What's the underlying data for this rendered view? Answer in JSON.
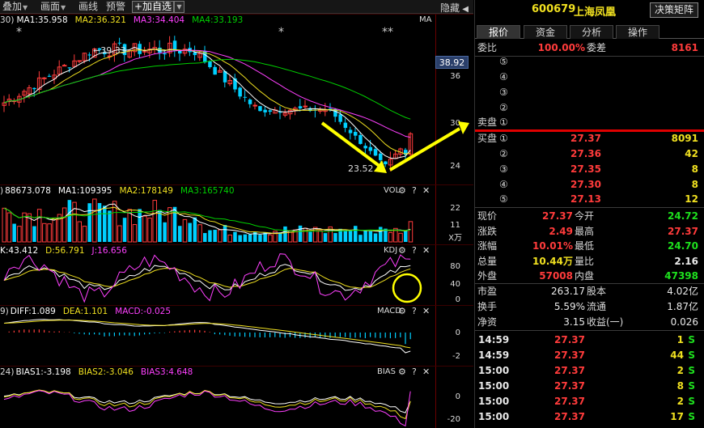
{
  "toolbar": {
    "overlay_label": "叠加",
    "draw_label": "画面",
    "line_label": "画线",
    "alert_label": "预警",
    "add_watch_label": "+加自选",
    "hide_label": "隐藏"
  },
  "kline": {
    "header_prefix": "30)",
    "ma1": "MA1:35.958",
    "ma2": "MA2:36.321",
    "ma3": "MA3:34.404",
    "ma4": "MA4:33.193",
    "ma_tag": "MA",
    "high_label": "←39.33",
    "low_label": "23.52",
    "star1": "*",
    "star2": "*",
    "star3": "**",
    "price_axis": [
      "36",
      "30",
      "24"
    ],
    "last_price_tag": "38.92"
  },
  "vol": {
    "header_prefix": ")",
    "vol_value": "88673.078",
    "ma1": "MA1:109395",
    "ma2": "MA2:178149",
    "ma3": "MA3:165740",
    "title": "VOL",
    "axis": [
      "22",
      "11"
    ],
    "unit": "X万"
  },
  "kdj": {
    "k": "K:43.412",
    "d": "D:56.791",
    "j": "J:16.656",
    "title": "KDJ",
    "axis": [
      "80",
      "40",
      "0"
    ]
  },
  "macd": {
    "header_prefix": "9)",
    "diff": "DIFF:1.089",
    "dea": "DEA:1.101",
    "macd": "MACD:-0.025",
    "title": "MACD",
    "axis": [
      "0",
      "-2"
    ]
  },
  "bias": {
    "header_prefix": "24)",
    "bias1": "BIAS1:-3.198",
    "bias2": "BIAS2:-3.046",
    "bias3": "BIAS3:4.648",
    "title": "BIAS",
    "axis": [
      "0",
      "-20"
    ]
  },
  "panel_icons": {
    "gear": "⚙",
    "help": "?",
    "close": "✕"
  },
  "quote": {
    "code": "600679",
    "name": "上海凤凰",
    "decision_button": "决策矩阵",
    "tabs": [
      "报价",
      "资金",
      "分析",
      "操作"
    ],
    "weibi_label": "委比",
    "weibi_value": "100.00%",
    "weicha_label": "委差",
    "weicha_value": "8161",
    "sell_label": "卖盘",
    "buy_label": "买盘",
    "sell_levels": [
      "⑤",
      "④",
      "③",
      "②",
      "①"
    ],
    "buy_levels": [
      {
        "level": "①",
        "price": "27.37",
        "volume": "8091"
      },
      {
        "level": "②",
        "price": "27.36",
        "volume": "42"
      },
      {
        "level": "③",
        "price": "27.35",
        "volume": "8"
      },
      {
        "level": "④",
        "price": "27.30",
        "volume": "8"
      },
      {
        "level": "⑤",
        "price": "27.13",
        "volume": "12"
      }
    ],
    "stats": [
      {
        "l1": "现价",
        "v1": "27.37",
        "c1": "red",
        "l2": "今开",
        "v2": "24.72",
        "c2": "green"
      },
      {
        "l1": "涨跌",
        "v1": "2.49",
        "c1": "red",
        "l2": "最高",
        "v2": "27.37",
        "c2": "red"
      },
      {
        "l1": "涨幅",
        "v1": "10.01%",
        "c1": "red",
        "l2": "最低",
        "v2": "24.70",
        "c2": "green"
      },
      {
        "l1": "总量",
        "v1": "10.44万",
        "c1": "yellow",
        "l2": "量比",
        "v2": "2.16",
        "c2": "white"
      },
      {
        "l1": "外盘",
        "v1": "57008",
        "c1": "red",
        "l2": "内盘",
        "v2": "47398",
        "c2": "green"
      }
    ],
    "stats2": [
      {
        "l1": "市盈",
        "v1": "263.17",
        "l2": "股本",
        "v2": "4.02亿"
      },
      {
        "l1": "换手",
        "v1": "5.59%",
        "l2": "流通",
        "v2": "1.87亿"
      },
      {
        "l1": "净资",
        "v1": "3.15",
        "l2": "收益(一)",
        "v2": "0.026"
      }
    ],
    "ticks": [
      {
        "time": "14:59",
        "price": "27.37",
        "vol": "1",
        "side": "S"
      },
      {
        "time": "14:59",
        "price": "27.37",
        "vol": "44",
        "side": "S"
      },
      {
        "time": "15:00",
        "price": "27.37",
        "vol": "2",
        "side": "S"
      },
      {
        "time": "15:00",
        "price": "27.37",
        "vol": "8",
        "side": "S"
      },
      {
        "time": "15:00",
        "price": "27.37",
        "vol": "2",
        "side": "S"
      },
      {
        "time": "15:00",
        "price": "27.37",
        "vol": "17",
        "side": "S"
      }
    ]
  },
  "colors": {
    "up": "#ff3b3b",
    "down": "#00d0ff",
    "ma1": "#ffffff",
    "ma2": "#f0e020",
    "ma3": "#ff40ff",
    "ma4": "#00d000",
    "annot": "#ffff00"
  }
}
